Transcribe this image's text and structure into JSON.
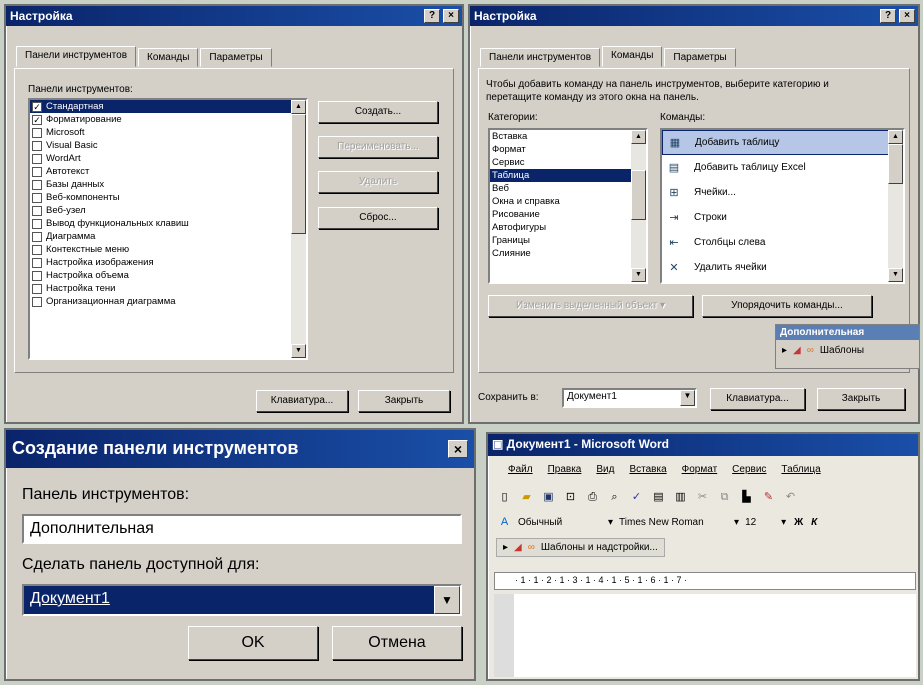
{
  "w1": {
    "title": "Настройка",
    "help": "?",
    "close": "×",
    "tabs": [
      "Панели инструментов",
      "Команды",
      "Параметры"
    ],
    "label": "Панели инструментов:",
    "items": [
      {
        "t": "Стандартная",
        "c": true
      },
      {
        "t": "Форматирование",
        "c": true
      },
      {
        "t": "Microsoft",
        "c": false
      },
      {
        "t": "Visual Basic",
        "c": false
      },
      {
        "t": "WordArt",
        "c": false
      },
      {
        "t": "Автотекст",
        "c": false
      },
      {
        "t": "Базы данных",
        "c": false
      },
      {
        "t": "Веб-компоненты",
        "c": false
      },
      {
        "t": "Веб-узел",
        "c": false
      },
      {
        "t": "Вывод функциональных клавиш",
        "c": false
      },
      {
        "t": "Диаграмма",
        "c": false
      },
      {
        "t": "Контекстные меню",
        "c": false
      },
      {
        "t": "Настройка изображения",
        "c": false
      },
      {
        "t": "Настройка объема",
        "c": false
      },
      {
        "t": "Настройка тени",
        "c": false
      },
      {
        "t": "Организационная диаграмма",
        "c": false
      }
    ],
    "btn_create": "Создать...",
    "btn_rename": "Переименовать...",
    "btn_delete": "Удалить",
    "btn_reset": "Сброс...",
    "btn_keyboard": "Клавиатура...",
    "btn_close": "Закрыть"
  },
  "w2": {
    "title": "Настройка",
    "help": "?",
    "close": "×",
    "tabs": [
      "Панели инструментов",
      "Команды",
      "Параметры"
    ],
    "desc": "Чтобы добавить команду на панель инструментов, выберите категорию и перетащите команду из этого окна на панель.",
    "cat_label": "Категории:",
    "cmd_label": "Команды:",
    "cats": [
      "Вставка",
      "Формат",
      "Сервис",
      "Таблица",
      "Веб",
      "Окна и справка",
      "Рисование",
      "Автофигуры",
      "Границы",
      "Слияние"
    ],
    "cmds": [
      {
        "i": "▦",
        "t": "Добавить таблицу"
      },
      {
        "i": "▤",
        "t": "Добавить таблицу Excel"
      },
      {
        "i": "⊞",
        "t": "Ячейки..."
      },
      {
        "i": "⇥",
        "t": "Строки"
      },
      {
        "i": "⇤",
        "t": "Столбцы слева"
      },
      {
        "i": "✕",
        "t": "Удалить ячейки"
      }
    ],
    "btn_modify": "Изменить выделенный объект",
    "btn_arrange": "Упорядочить команды...",
    "float_title": "Дополнительная",
    "float_item": "Шаблоны",
    "save_label": "Сохранить в:",
    "save_value": "Документ1",
    "btn_keyboard": "Клавиатура...",
    "btn_close": "Закрыть"
  },
  "w3": {
    "title": "Создание панели инструментов",
    "close": "×",
    "name_label": "Панель инструментов:",
    "name_value": "Дополнительная",
    "avail_label": "Сделать панель доступной для:",
    "avail_value": "Документ1",
    "btn_ok": "OK",
    "btn_cancel": "Отмена"
  },
  "w4": {
    "title": "Документ1 - Microsoft Word",
    "menu": [
      "Файл",
      "Правка",
      "Вид",
      "Вставка",
      "Формат",
      "Сервис",
      "Таблица"
    ],
    "style": "Обычный",
    "font": "Times New Roman",
    "size": "12",
    "bold": "Ж",
    "italic": "К",
    "addon": "Шаблоны и надстройки...",
    "ruler": "· 1 · 1 · 2 · 1 · 3 · 1 · 4 · 1 · 5 · 1 · 6 · 1 · 7 ·"
  }
}
